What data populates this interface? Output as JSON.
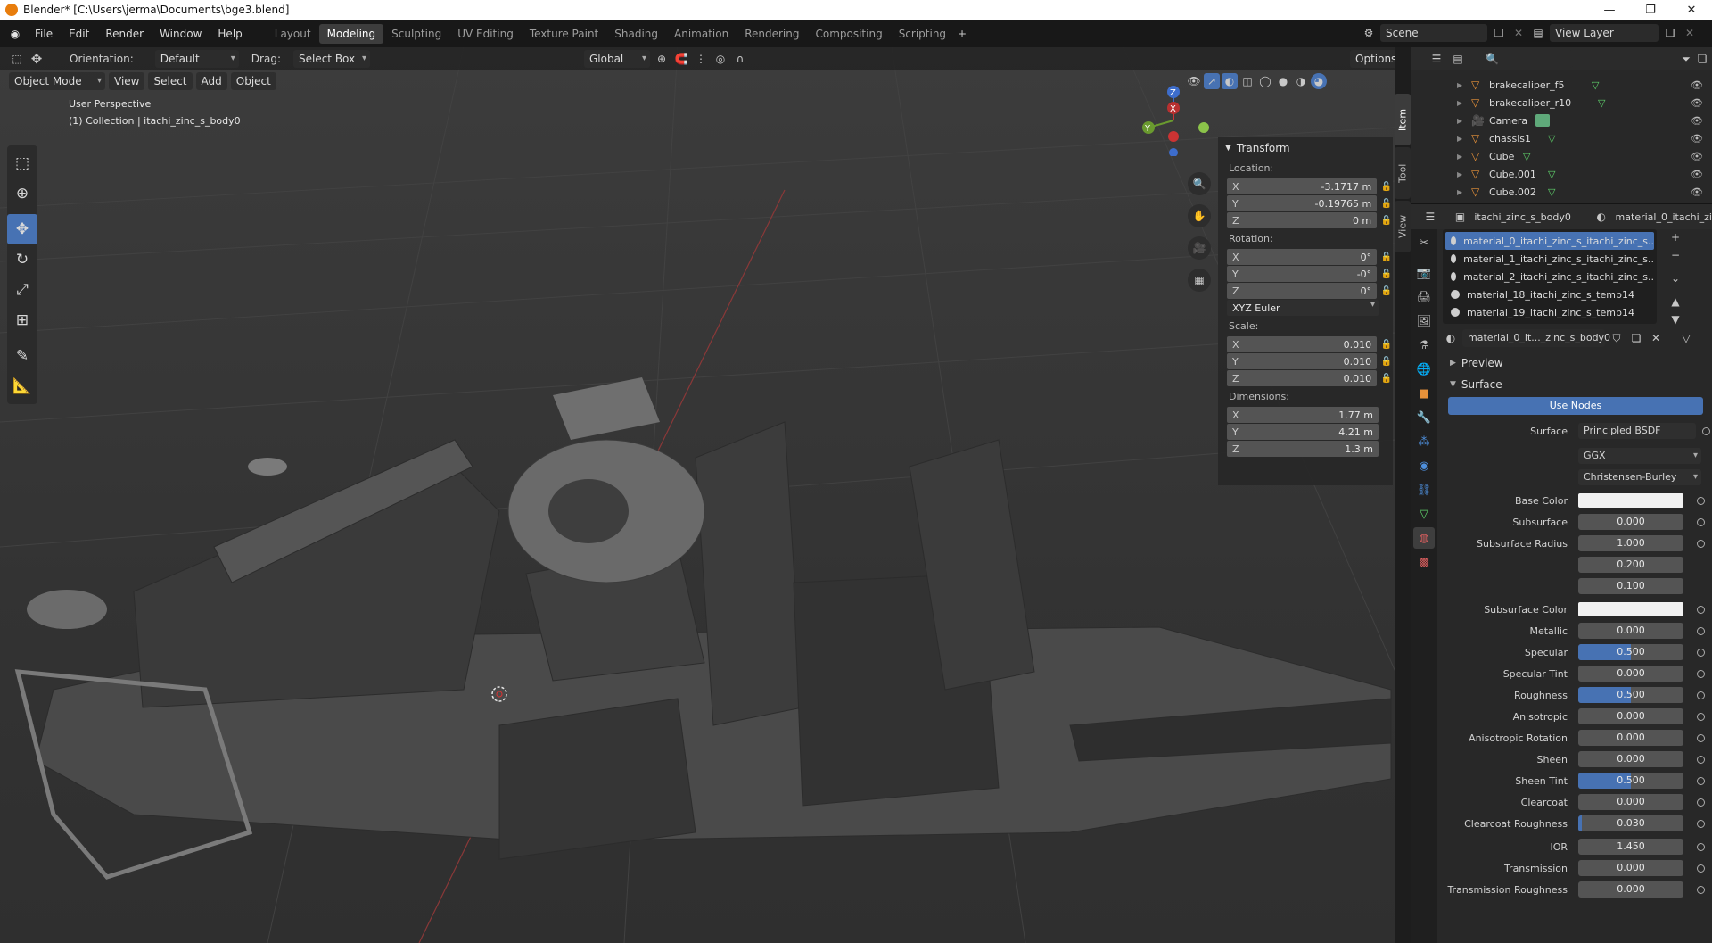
{
  "window": {
    "title": "Blender* [C:\\Users\\jerma\\Documents\\bge3.blend]"
  },
  "menu": [
    "File",
    "Edit",
    "Render",
    "Window",
    "Help"
  ],
  "workspaces": [
    "Layout",
    "Modeling",
    "Sculpting",
    "UV Editing",
    "Texture Paint",
    "Shading",
    "Animation",
    "Rendering",
    "Compositing",
    "Scripting"
  ],
  "active_workspace": "Modeling",
  "scene": {
    "name": "Scene",
    "view_layer": "View Layer"
  },
  "tool_header": {
    "orientation_label": "Orientation:",
    "orientation_value": "Default",
    "drag_label": "Drag:",
    "drag_value": "Select Box",
    "transform_space": "Global",
    "options": "Options"
  },
  "viewport_header": {
    "mode": "Object Mode",
    "menus": [
      "View",
      "Select",
      "Add",
      "Object"
    ]
  },
  "viewport": {
    "title": "User Perspective",
    "subtitle": "(1) Collection | itachi_zinc_s_body0",
    "gizmo": {
      "x": "X",
      "y": "Y",
      "z": "Z"
    }
  },
  "n_panel": {
    "tabs": [
      "Item",
      "Tool",
      "View"
    ],
    "header": "Transform",
    "location_label": "Location:",
    "location": [
      {
        "axis": "X",
        "value": "-3.1717 m"
      },
      {
        "axis": "Y",
        "value": "-0.19765 m"
      },
      {
        "axis": "Z",
        "value": "0 m"
      }
    ],
    "rotation_label": "Rotation:",
    "rotation": [
      {
        "axis": "X",
        "value": "0°"
      },
      {
        "axis": "Y",
        "value": "-0°"
      },
      {
        "axis": "Z",
        "value": "0°"
      }
    ],
    "rotation_mode": "XYZ Euler",
    "scale_label": "Scale:",
    "scale": [
      {
        "axis": "X",
        "value": "0.010"
      },
      {
        "axis": "Y",
        "value": "0.010"
      },
      {
        "axis": "Z",
        "value": "0.010"
      }
    ],
    "dimensions_label": "Dimensions:",
    "dimensions": [
      {
        "axis": "X",
        "value": "1.77 m"
      },
      {
        "axis": "Y",
        "value": "4.21 m"
      },
      {
        "axis": "Z",
        "value": "1.3 m"
      }
    ]
  },
  "outliner": {
    "items": [
      {
        "name": "brakecaliper_f5",
        "type": "mesh"
      },
      {
        "name": "brakecaliper_r10",
        "type": "mesh"
      },
      {
        "name": "Camera",
        "type": "camera"
      },
      {
        "name": "chassis1",
        "type": "mesh"
      },
      {
        "name": "Cube",
        "type": "mesh"
      },
      {
        "name": "Cube.001",
        "type": "mesh"
      },
      {
        "name": "Cube.002",
        "type": "mesh"
      }
    ]
  },
  "properties": {
    "breadcrumb_object": "itachi_zinc_s_body0",
    "breadcrumb_material": "material_0_itachi_zi",
    "slots": [
      "material_0_itachi_zinc_s_itachi_zinc_s..",
      "material_1_itachi_zinc_s_itachi_zinc_s..",
      "material_2_itachi_zinc_s_itachi_zinc_s..",
      "material_18_itachi_zinc_s_temp14",
      "material_19_itachi_zinc_s_temp14"
    ],
    "material_name": "material_0_it..._zinc_s_body0",
    "preview_label": "Preview",
    "surface_label": "Surface",
    "use_nodes": "Use Nodes",
    "surface_field_label": "Surface",
    "surface_shader": "Principled BSDF",
    "distribution": "GGX",
    "subsurface_method": "Christensen-Burley",
    "params": [
      {
        "label": "Base Color",
        "kind": "color",
        "value": "#f2f2f2"
      },
      {
        "label": "Subsurface",
        "value": "0.000",
        "fill": 0
      },
      {
        "label": "Subsurface Radius",
        "value": "1.000",
        "fill": 0
      },
      {
        "label": "",
        "value": "0.200",
        "fill": 0
      },
      {
        "label": "",
        "value": "0.100",
        "fill": 0
      },
      {
        "label": "Subsurface Color",
        "kind": "color",
        "value": "#f2f2f2"
      },
      {
        "label": "Metallic",
        "value": "0.000",
        "fill": 0
      },
      {
        "label": "Specular",
        "value": "0.500",
        "fill": 0.5
      },
      {
        "label": "Specular Tint",
        "value": "0.000",
        "fill": 0
      },
      {
        "label": "Roughness",
        "value": "0.500",
        "fill": 0.5
      },
      {
        "label": "Anisotropic",
        "value": "0.000",
        "fill": 0
      },
      {
        "label": "Anisotropic Rotation",
        "value": "0.000",
        "fill": 0
      },
      {
        "label": "Sheen",
        "value": "0.000",
        "fill": 0
      },
      {
        "label": "Sheen Tint",
        "value": "0.500",
        "fill": 0.5
      },
      {
        "label": "Clearcoat",
        "value": "0.000",
        "fill": 0
      },
      {
        "label": "Clearcoat Roughness",
        "value": "0.030",
        "fill": 0.03
      },
      {
        "label": "IOR",
        "value": "1.450",
        "fill": 0
      },
      {
        "label": "Transmission",
        "value": "0.000",
        "fill": 0
      },
      {
        "label": "Transmission Roughness",
        "value": "0.000",
        "fill": 0
      }
    ]
  },
  "colors": {
    "accent": "#4772b3",
    "object_icon": "#e8923a",
    "mesh_data": "#5fd46b"
  }
}
